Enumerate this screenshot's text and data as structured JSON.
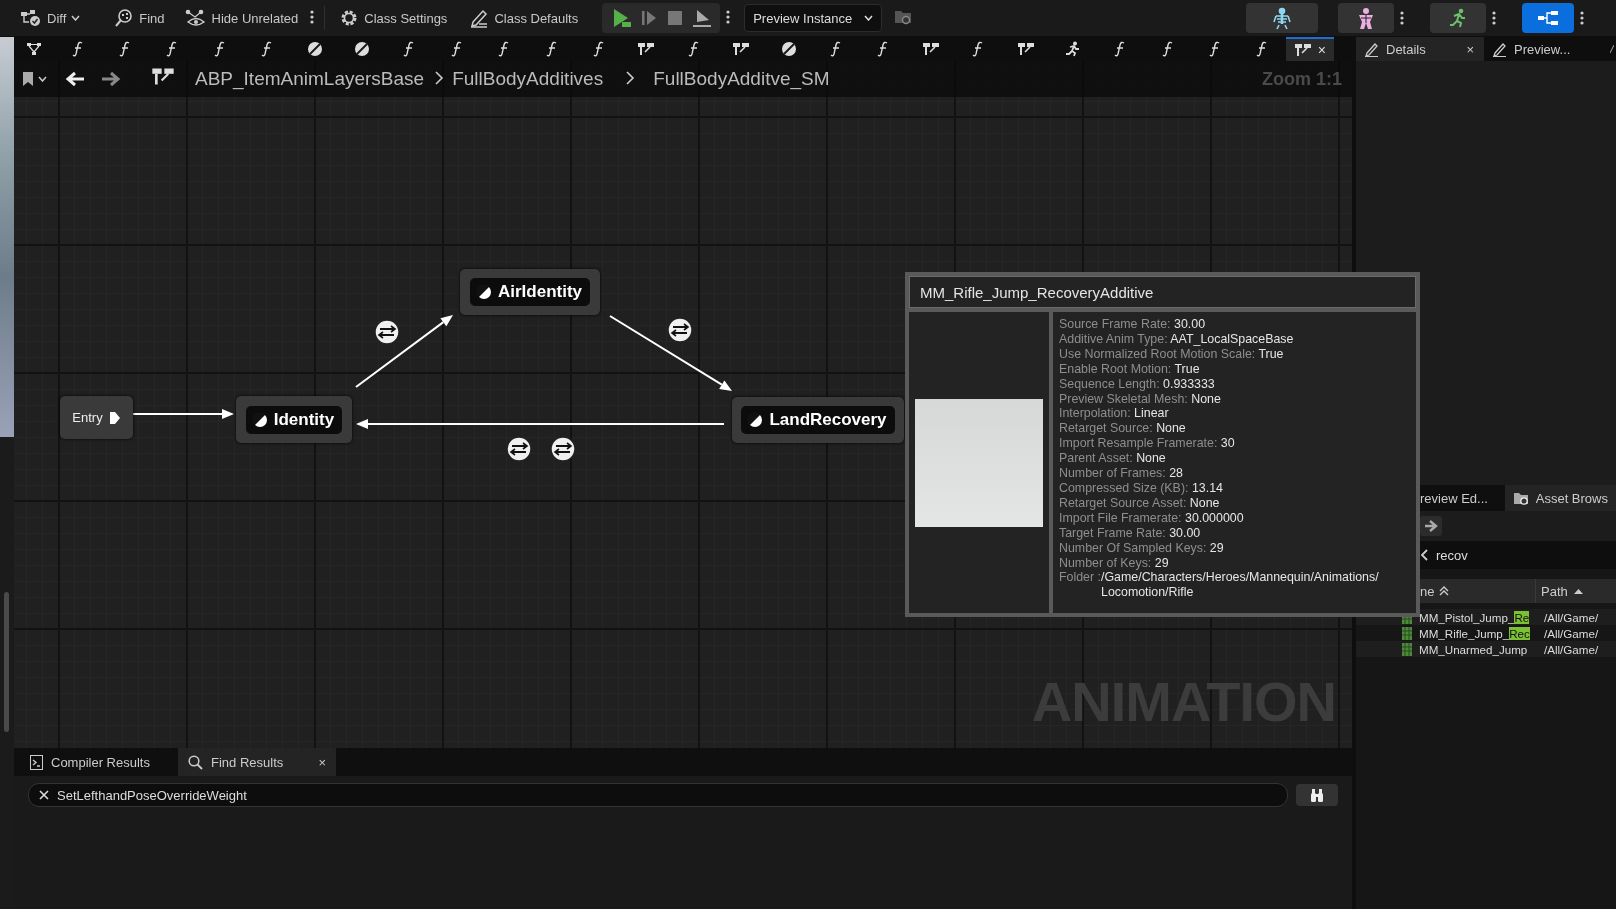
{
  "toolbar": {
    "buttons": [
      {
        "kind": "diff",
        "label": "Diff"
      },
      {
        "kind": "find",
        "label": "Find"
      },
      {
        "kind": "hide-unrelated",
        "label": "Hide Unrelated"
      },
      {
        "kind": "class-settings",
        "label": "Class Settings"
      },
      {
        "kind": "class-defaults",
        "label": "Class Defaults"
      }
    ],
    "preview_instance": "Preview Instance",
    "modes": [
      {
        "kind": "skeleton",
        "selected": false
      },
      {
        "kind": "mesh",
        "selected": false
      },
      {
        "kind": "animation",
        "selected": false
      },
      {
        "kind": "blueprint",
        "selected": true
      }
    ]
  },
  "graph_tabs": {
    "close": "×",
    "items": [
      {
        "kind": "graph",
        "selected": false
      },
      {
        "kind": "function",
        "selected": false
      },
      {
        "kind": "function",
        "selected": false
      },
      {
        "kind": "function",
        "selected": false
      },
      {
        "kind": "function",
        "selected": false
      },
      {
        "kind": "function",
        "selected": false
      },
      {
        "kind": "state",
        "selected": false
      },
      {
        "kind": "state",
        "selected": false
      },
      {
        "kind": "function",
        "selected": false
      },
      {
        "kind": "function",
        "selected": false
      },
      {
        "kind": "function",
        "selected": false
      },
      {
        "kind": "function",
        "selected": false
      },
      {
        "kind": "function",
        "selected": false
      },
      {
        "kind": "state-machine",
        "selected": false
      },
      {
        "kind": "function",
        "selected": false
      },
      {
        "kind": "state-machine",
        "selected": false
      },
      {
        "kind": "state",
        "selected": false
      },
      {
        "kind": "function",
        "selected": false
      },
      {
        "kind": "function",
        "selected": false
      },
      {
        "kind": "state-machine",
        "selected": false
      },
      {
        "kind": "function",
        "selected": false
      },
      {
        "kind": "state-machine",
        "selected": false
      },
      {
        "kind": "run",
        "selected": false
      },
      {
        "kind": "function",
        "selected": false
      },
      {
        "kind": "function",
        "selected": false
      },
      {
        "kind": "function",
        "selected": false
      },
      {
        "kind": "function",
        "selected": false
      },
      {
        "kind": "state-machine",
        "selected": true
      }
    ]
  },
  "breadcrumb": {
    "path": [
      "ABP_ItemAnimLayersBase",
      "FullBodyAdditives",
      "FullBodyAdditve_SM"
    ],
    "zoom": "Zoom 1:1"
  },
  "graph": {
    "nodes": [
      {
        "kind": "entry",
        "label": "Entry"
      },
      {
        "kind": "state",
        "label": "Identity"
      },
      {
        "kind": "state",
        "label": "AirIdentity"
      },
      {
        "kind": "state",
        "label": "LandRecovery"
      }
    ],
    "graph_type": "ANIMATION"
  },
  "tooltip": {
    "title": "MM_Rifle_Jump_RecoveryAdditive",
    "properties": [
      {
        "name": "Source Frame Rate:",
        "value": "30.00"
      },
      {
        "name": "Additive Anim Type:",
        "value": "AAT_LocalSpaceBase"
      },
      {
        "name": "Use Normalized Root Motion Scale:",
        "value": "True"
      },
      {
        "name": "Enable Root Motion:",
        "value": "True"
      },
      {
        "name": "Sequence Length:",
        "value": "0.933333"
      },
      {
        "name": "Preview Skeletal Mesh:",
        "value": "None"
      },
      {
        "name": "Interpolation:",
        "value": "Linear"
      },
      {
        "name": "Retarget Source:",
        "value": "None"
      },
      {
        "name": "Import Resample Framerate:",
        "value": "30"
      },
      {
        "name": "Parent Asset:",
        "value": "None"
      },
      {
        "name": "Number of Frames:",
        "value": "28"
      },
      {
        "name": "Compressed Size (KB):",
        "value": "13.14"
      },
      {
        "name": "Retarget Source Asset:",
        "value": "None"
      },
      {
        "name": "Import File Framerate:",
        "value": "30.000000"
      },
      {
        "name": "Target Frame Rate:",
        "value": "30.00"
      },
      {
        "name": "Number Of Sampled Keys:",
        "value": "29"
      },
      {
        "name": "Number of Keys:",
        "value": "29"
      },
      {
        "name": "Folder :",
        "value": "/Game/Characters/Heroes/Mannequin/Animations/Locomotion/Rifle"
      }
    ]
  },
  "details_tabs": {
    "close": "×",
    "items": [
      {
        "label": "Details",
        "selected": true
      },
      {
        "label": "Preview...",
        "selected": false
      }
    ]
  },
  "asset_panel": {
    "tabs": [
      {
        "label": "review Ed...",
        "selected": false
      },
      {
        "label": "Asset Brows",
        "selected": true
      }
    ],
    "search": {
      "value": "recov"
    },
    "columns": [
      "ne",
      "Path"
    ],
    "rows": [
      {
        "name": "MM_Pistol_Jump_",
        "match": "Re",
        "path": "/All/Game/"
      },
      {
        "name": "MM_Rifle_Jump_",
        "match": "Rec",
        "path": "/All/Game/"
      },
      {
        "name": "MM_Unarmed_Jump",
        "path": "/All/Game/"
      }
    ]
  },
  "bottom_panel": {
    "close": "×",
    "tabs": [
      {
        "kind": "compiler",
        "label": "Compiler Results",
        "selected": false
      },
      {
        "kind": "find",
        "label": "Find Results",
        "selected": true
      }
    ],
    "find_field": {
      "value": "SetLefthandPoseOverrideWeight"
    }
  }
}
